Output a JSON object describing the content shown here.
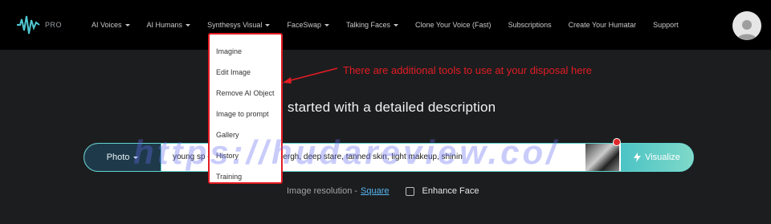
{
  "logo": {
    "badge": "PRO"
  },
  "nav": {
    "items": [
      {
        "label": "AI Voices",
        "has_caret": true
      },
      {
        "label": "AI Humans",
        "has_caret": true
      },
      {
        "label": "Synthesys Visual",
        "has_caret": true
      },
      {
        "label": "FaceSwap",
        "has_caret": true
      },
      {
        "label": "Talking Faces",
        "has_caret": true
      },
      {
        "label": "Clone Your Voice (Fast)",
        "has_caret": false
      },
      {
        "label": "Subscriptions",
        "has_caret": false
      },
      {
        "label": "Create Your Humatar",
        "has_caret": false
      },
      {
        "label": "Support",
        "has_caret": false
      }
    ]
  },
  "dropdown": {
    "items": [
      "Imagine",
      "Edit Image",
      "Remove AI Object",
      "Image to prompt",
      "Gallery",
      "History",
      "Training"
    ]
  },
  "annotation": {
    "text": "There are additional tools to use at your disposal here"
  },
  "hero": {
    "title": "started with a detailed description"
  },
  "prompt_bar": {
    "mode_label": "Photo",
    "prompt_value": "young sp          e style of Peter Lindbergh, deep stare, tanned skin, light makeup, shinin",
    "visualize_label": "Visualize"
  },
  "options": {
    "resolution_label": "Image resolution -",
    "resolution_value": "Square",
    "enhance_label": "Enhance Face"
  },
  "watermark": {
    "text": "https://hudareview.co/"
  },
  "colors": {
    "accent": "#5fd3cf",
    "annotation": "#e31c23",
    "link": "#56b6f0"
  }
}
